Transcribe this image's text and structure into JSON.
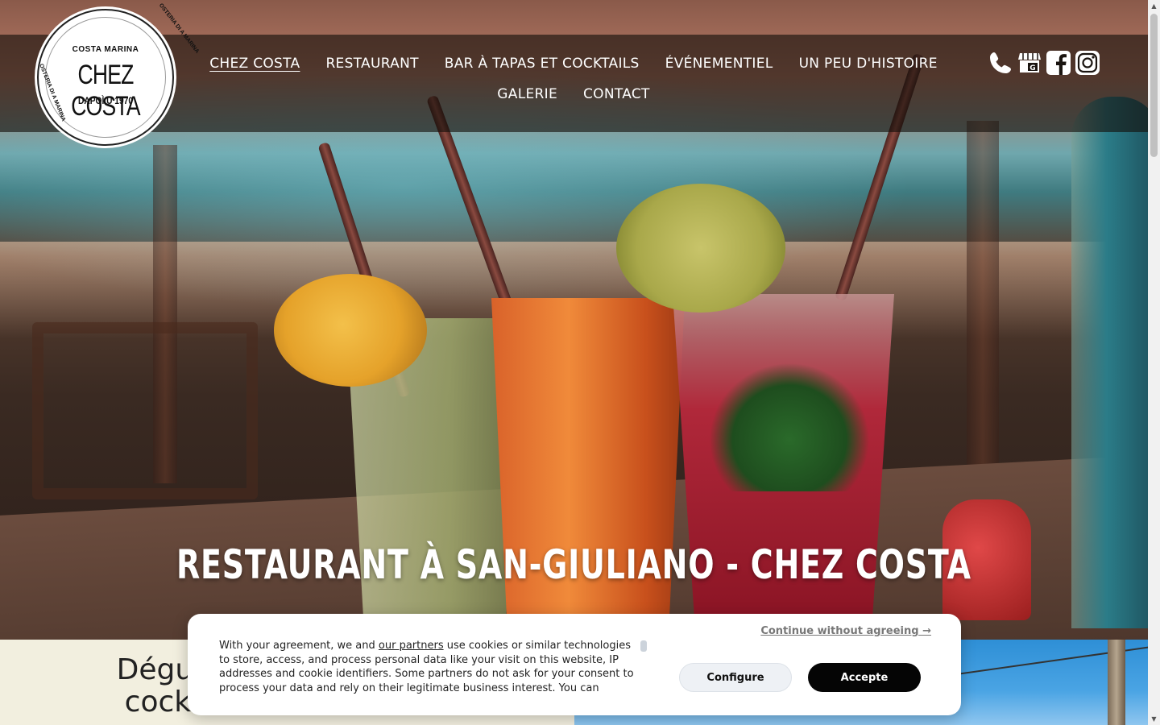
{
  "logo": {
    "top": "COSTA MARINA",
    "main": "CHEZ COSTA",
    "sub": "DAPOÌ U 1970",
    "ring_left": "OSTERIA DI A MARINA",
    "ring_right": "OSTERIA DI A MARINA"
  },
  "nav": {
    "items": [
      {
        "label": "CHEZ COSTA",
        "active": true
      },
      {
        "label": "RESTAURANT"
      },
      {
        "label": "BAR À TAPAS ET COCKTAILS"
      },
      {
        "label": "ÉVÉNEMENTIEL"
      },
      {
        "label": "UN PEU D'HISTOIRE"
      },
      {
        "label": "GALERIE"
      },
      {
        "label": "CONTACT"
      }
    ]
  },
  "social": {
    "icons": [
      "phone-icon",
      "google-business-icon",
      "facebook-icon",
      "instagram-icon"
    ]
  },
  "hero": {
    "title": "RESTAURANT À SAN-GIULIANO - CHEZ COSTA"
  },
  "section": {
    "heading_line1": "Dégustez n",
    "heading_line2": "cocktails r"
  },
  "cookie": {
    "text_before_link": "With your agreement, we and ",
    "link": "our partners",
    "text_after_link": " use cookies or similar technologies to store, access, and process personal data like your visit on this website, IP addresses and cookie identifiers. Some partners do not ask for your consent to process your data and rely on their legitimate business interest. You can",
    "continue": "Continue without agreeing →",
    "configure": "Configure",
    "accept": "Accepte"
  },
  "colors": {
    "nav_bg": "#140e0a",
    "accept_btn": "#050505",
    "left_panel": "#f2efdf"
  }
}
